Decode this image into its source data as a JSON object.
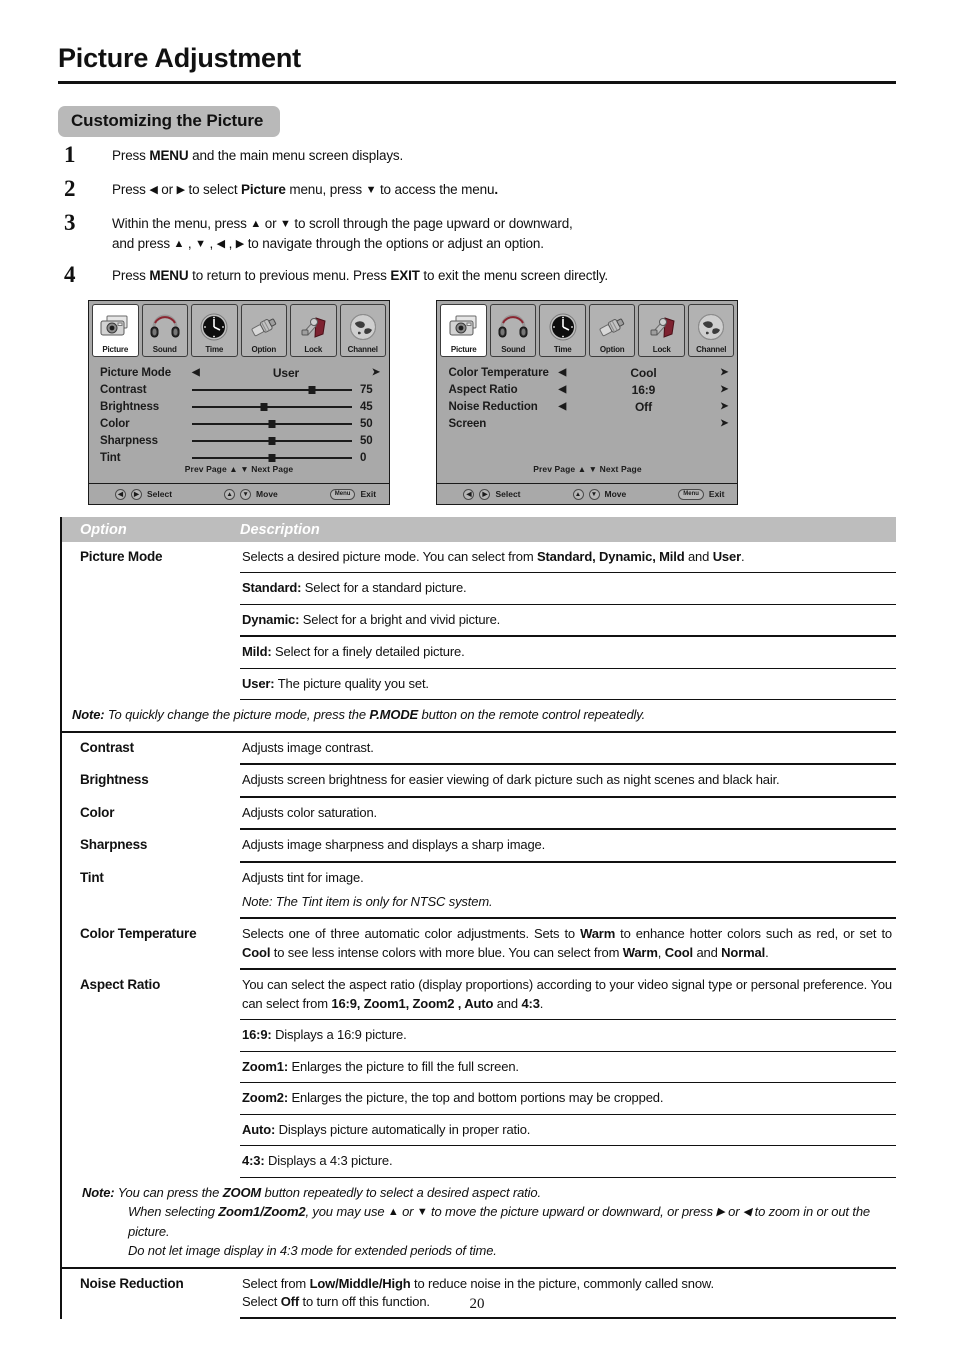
{
  "document": {
    "title": "Picture Adjustment",
    "section_heading": "Customizing the Picture",
    "page_number": "20"
  },
  "steps": [
    {
      "num": "1",
      "html": "Press <b>MENU</b> and the main menu screen displays."
    },
    {
      "num": "2",
      "html": "Press <span class=\"ar\">◀</span> or <span class=\"ar\">▶</span> to select <b>Picture</b> menu,  press <span class=\"ar\">▼</span> to access the menu<b>.</b>"
    },
    {
      "num": "3",
      "html": "Within the menu, press <span class=\"ar\">▲</span>  or <span class=\"ar\">▼</span>  to scroll through the page upward or downward,<br>and press <span class=\"ar\">▲</span> , <span class=\"ar\">▼</span> , <span class=\"ar\">◀</span> , <span class=\"ar\">▶</span> to navigate through the options or adjust an option."
    },
    {
      "num": "4",
      "html": "Press <b>MENU</b> to return to previous menu. Press <b>EXIT</b> to exit the menu screen directly."
    }
  ],
  "osd": {
    "tabs": [
      {
        "label": "Picture",
        "icon": "camera-icon",
        "active": true
      },
      {
        "label": "Sound",
        "icon": "headphones-icon",
        "active": false
      },
      {
        "label": "Time",
        "icon": "clock-icon",
        "active": false
      },
      {
        "label": "Option",
        "icon": "connector-icon",
        "active": false
      },
      {
        "label": "Lock",
        "icon": "padlock-icon",
        "active": false
      },
      {
        "label": "Channel",
        "icon": "globe-icon",
        "active": false
      }
    ],
    "pager": "Prev  Page ▲  ▼ Next  Page",
    "footer": {
      "select_keys": "◀▶",
      "select_label": "Select",
      "move_keys": "▲▼",
      "move_label": "Move",
      "exit_key": "Menu",
      "exit_label": "Exit"
    },
    "left_panel": {
      "rows": [
        {
          "type": "option",
          "label": "Picture Mode",
          "value": "User",
          "left_arrow": "◀",
          "right_arrow": "➤"
        },
        {
          "type": "slider",
          "label": "Contrast",
          "value": "75",
          "pos": 75
        },
        {
          "type": "slider",
          "label": "Brightness",
          "value": "45",
          "pos": 45
        },
        {
          "type": "slider",
          "label": "Color",
          "value": "50",
          "pos": 50
        },
        {
          "type": "slider",
          "label": "Sharpness",
          "value": "50",
          "pos": 50
        },
        {
          "type": "slider",
          "label": "Tint",
          "value": "0",
          "pos": 50
        }
      ]
    },
    "right_panel": {
      "rows": [
        {
          "type": "option",
          "label": "Color Temperature",
          "value": "Cool",
          "left_arrow": "◀",
          "right_arrow": "➤"
        },
        {
          "type": "option",
          "label": "Aspect Ratio",
          "value": "16:9",
          "left_arrow": "◀",
          "right_arrow": "➤"
        },
        {
          "type": "option",
          "label": "Noise Reduction",
          "value": "Off",
          "left_arrow": "◀",
          "right_arrow": "➤"
        },
        {
          "type": "submenu",
          "label": "Screen",
          "value": "",
          "left_arrow": "",
          "right_arrow": "➤"
        }
      ]
    }
  },
  "table": {
    "header": {
      "option": "Option",
      "description": "Description"
    },
    "rows": [
      {
        "option": "Picture Mode",
        "cells": [
          "Selects a desired picture mode. You can select from <b>Standard, Dynamic, Mild</b> and <b>User</b>.",
          "<b>Standard:</b> Select for a standard picture.",
          "<b>Dynamic:</b> Select for a bright and vivid picture.",
          "<b>Mild:</b> Select for a finely detailed picture.",
          "<b>User:</b> The picture quality you set."
        ],
        "note": "<span class=\"nb\">Note:</span> To quickly change the picture mode, press the <span class=\"nb\">P.MODE</span> button on the remote control repeatedly."
      },
      {
        "option": "Contrast",
        "cells": [
          "Adjusts image contrast."
        ]
      },
      {
        "option": "Brightness",
        "cells": [
          "Adjusts screen brightness for easier viewing of dark picture such as night scenes and black hair."
        ]
      },
      {
        "option": "Color",
        "cells": [
          "Adjusts color saturation."
        ]
      },
      {
        "option": "Sharpness",
        "cells": [
          "Adjusts image sharpness and displays a sharp image."
        ]
      },
      {
        "option": "Tint",
        "cells": [
          "Adjusts tint for image."
        ],
        "inline_note": "<span class=\"nb\">Note:</span> The Tint item is only for NTSC system."
      },
      {
        "option": "Color Temperature",
        "cells": [
          "Selects one of three automatic color adjustments.  Sets to <b>Warm</b> to enhance hotter colors such as red,  or set to <b>Cool</b> to see less intense colors with more blue.  You can select from <b>Warm</b>, <b>Cool</b> and <b>Normal</b>."
        ]
      },
      {
        "option": "Aspect Ratio",
        "cells": [
          "You can select the aspect ratio (display proportions) according to your video signal type or personal preference. You can select from <b>16:9,  Zoom1, Zoom2 , Auto</b> and <b>4:3</b>.",
          "<b>16:9:</b> Displays a 16:9 picture.",
          "<b>Zoom1:</b> Enlarges the picture to fill the full screen.",
          "<b>Zoom2:</b> Enlarges the picture, the top and bottom portions may be cropped.",
          "<b>Auto:</b> Displays picture automatically in proper ratio.",
          "<b>4:3:</b> Displays a 4:3 picture."
        ],
        "note_lines": [
          "<span class=\"nb\">Note:</span> You can press the <span class=\"nb\">ZOOM</span> button repeatedly to select a desired aspect ratio.",
          "When selecting <span class=\"nb\">Zoom1/Zoom2</span>, you may use <span class=\"ar\">▲</span> or <span class=\"ar\">▼</span> to move the picture upward or downward, or press <span class=\"ar\">▶</span> or <span class=\"ar\">◀</span>  to zoom in or out the picture.",
          "Do not let image display in 4:3 mode for extended periods of time."
        ]
      },
      {
        "option": "Noise Reduction",
        "cells": [
          "Select from <b>Low/Middle/High</b> to reduce noise in the picture, commonly called snow.<br>Select <b>Off</b> to turn off this function."
        ]
      }
    ]
  }
}
